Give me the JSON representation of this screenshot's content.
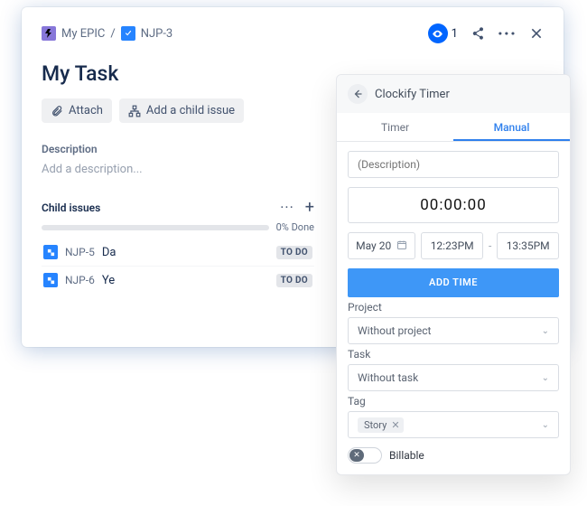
{
  "breadcrumbs": {
    "epic_label": "My EPIC",
    "issue_key": "NJP-3"
  },
  "header": {
    "watch_count": "1"
  },
  "issue": {
    "title": "My Task",
    "attach_label": "Attach",
    "add_child_label": "Add a child issue",
    "description_heading": "Description",
    "description_placeholder": "Add a description...",
    "child_heading": "Child issues",
    "progress_label": "0% Done",
    "children": [
      {
        "key": "NJP-5",
        "summary": "Da",
        "status": "TO DO"
      },
      {
        "key": "NJP-6",
        "summary": "Ye",
        "status": "TO DO"
      }
    ]
  },
  "clockify": {
    "title": "Clockify Timer",
    "tabs": {
      "timer": "Timer",
      "manual": "Manual"
    },
    "desc_placeholder": "(Description)",
    "duration": "00:00:00",
    "date": "May 20",
    "start_time": "12:23PM",
    "end_time": "13:35PM",
    "add_time_label": "ADD TIME",
    "project_label": "Project",
    "project_value": "Without project",
    "task_label": "Task",
    "task_value": "Without task",
    "tag_label": "Tag",
    "tag_chip": "Story",
    "billable_label": "Billable"
  }
}
